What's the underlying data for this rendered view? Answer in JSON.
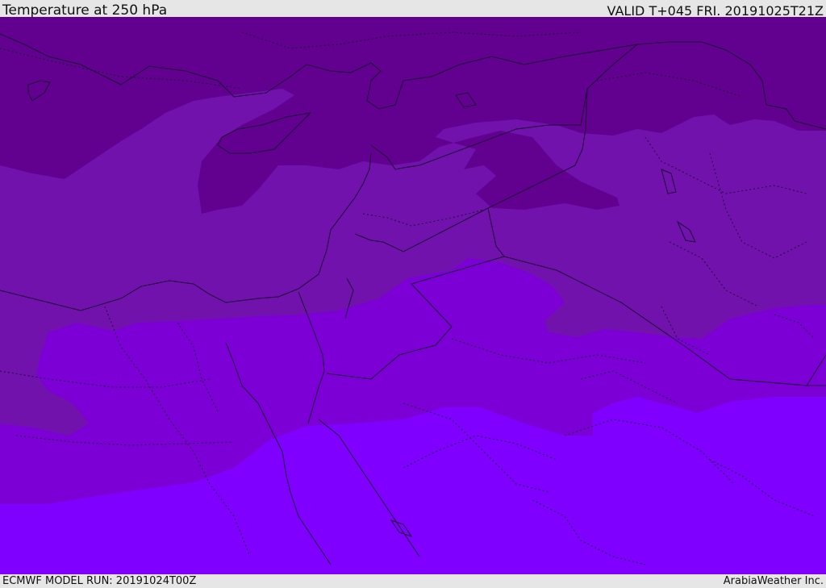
{
  "header": {
    "title": "Temperature at 250 hPa",
    "valid": "VALID T+045 FRI. 20191025T21Z"
  },
  "footer": {
    "model_run": "ECMWF MODEL RUN: 20191024T00Z",
    "credit": "ArabiaWeather Inc."
  },
  "map": {
    "colors": {
      "band_darkest": "#62008f",
      "band_dark": "#7212ad",
      "band_mid": "#7c00d6",
      "band_light": "#7f00ff",
      "border_line": "#1a0033"
    }
  }
}
